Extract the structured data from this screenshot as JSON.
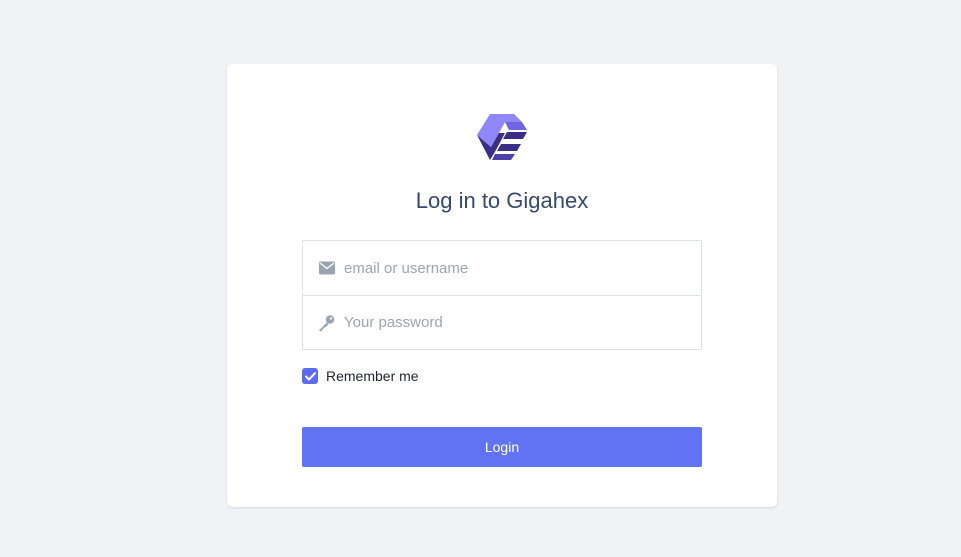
{
  "app": {
    "title": "Log in to Gigahex",
    "logo_icon": "gigahex-logo-icon"
  },
  "form": {
    "username": {
      "icon": "envelope-icon",
      "value": "",
      "placeholder": "email or username"
    },
    "password": {
      "icon": "key-icon",
      "value": "",
      "placeholder": "Your password"
    },
    "remember": {
      "label": "Remember me",
      "checked": true
    },
    "submit_label": "Login"
  },
  "colors": {
    "background": "#f0f2f5",
    "card": "#ffffff",
    "title": "#354a6e",
    "accent": "#5f73f3",
    "logo_light": "#8f86f7",
    "logo_dark": "#3a2e86"
  }
}
